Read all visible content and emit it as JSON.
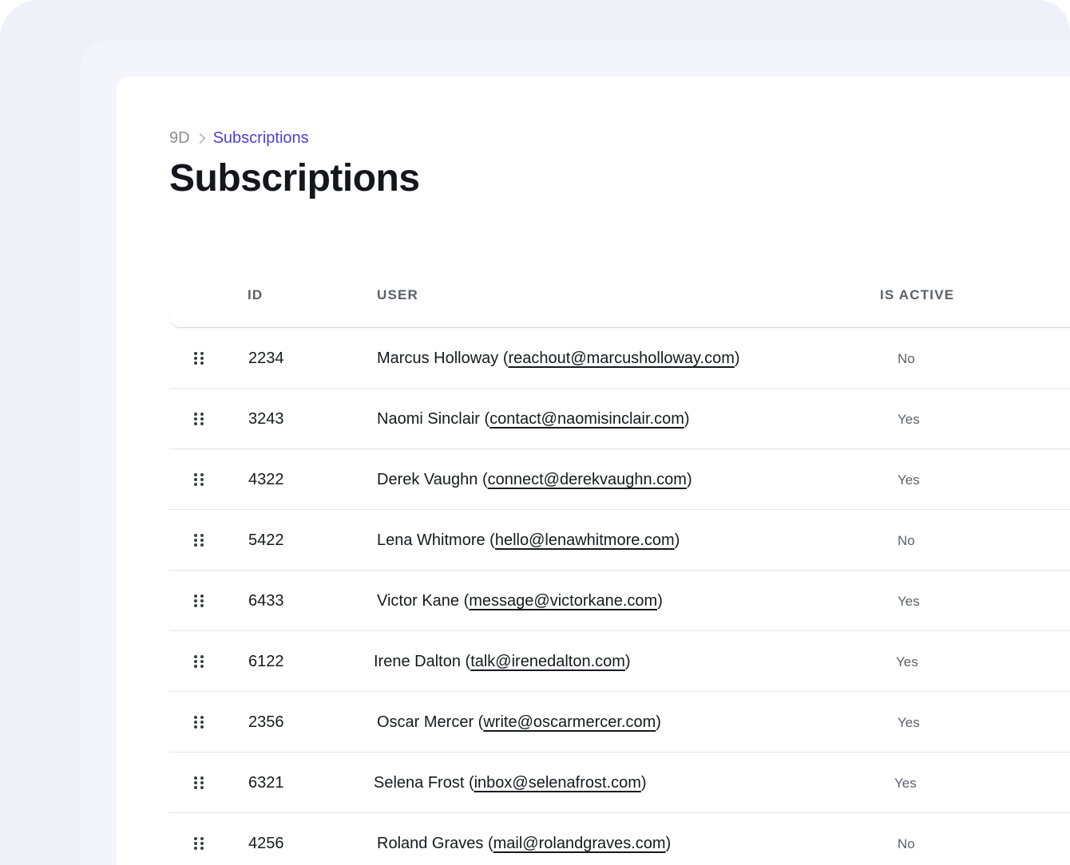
{
  "breadcrumb": {
    "root": "9D",
    "current": "Subscriptions"
  },
  "page": {
    "title": "Subscriptions"
  },
  "table": {
    "columns": {
      "id": "ID",
      "user": "USER",
      "is_active": "IS ACTIVE"
    },
    "rows": [
      {
        "id": "2234",
        "name": "Marcus Holloway",
        "email": "reachout@marcusholloway.com",
        "active": "No"
      },
      {
        "id": "3243",
        "name": "Naomi Sinclair",
        "email": "contact@naomisinclair.com",
        "active": "Yes"
      },
      {
        "id": "4322",
        "name": "Derek Vaughn",
        "email": "connect@derekvaughn.com",
        "active": "Yes"
      },
      {
        "id": "5422",
        "name": "Lena Whitmore",
        "email": "hello@lenawhitmore.com",
        "active": "No"
      },
      {
        "id": "6433",
        "name": "Victor Kane",
        "email": "message@victorkane.com",
        "active": "Yes"
      },
      {
        "id": "6122",
        "name": "Irene Dalton",
        "email": "talk@irenedalton.com",
        "active": "Yes"
      },
      {
        "id": "2356",
        "name": "Oscar Mercer",
        "email": "write@oscarmercer.com",
        "active": "Yes"
      },
      {
        "id": "6321",
        "name": "Selena Frost",
        "email": "inbox@selenafrost.com",
        "active": "Yes"
      },
      {
        "id": "4256",
        "name": "Roland Graves",
        "email": "mail@rolandgraves.com",
        "active": "No"
      }
    ]
  },
  "icons": {
    "drag_handle": "drag-handle-icon",
    "breadcrumb_separator": "chevron-right-icon"
  },
  "colors": {
    "accent": "#4f3fd6",
    "text": "#17191f",
    "muted": "#5d616b"
  }
}
